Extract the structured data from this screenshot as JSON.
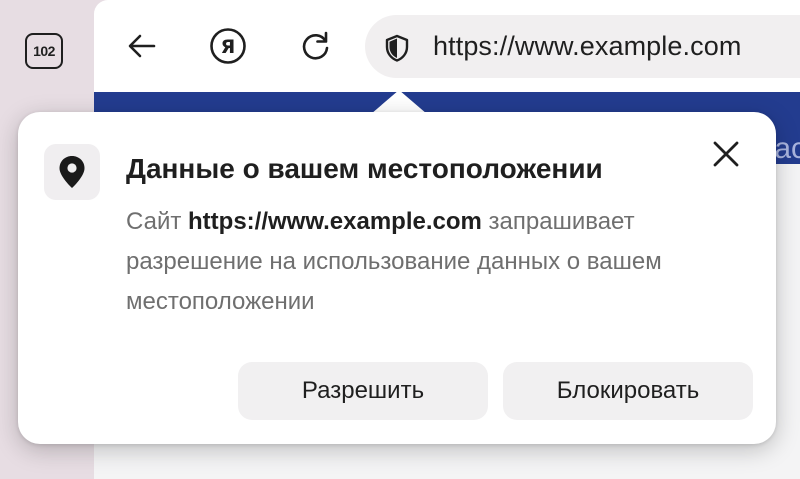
{
  "tabs": {
    "count_label": "102"
  },
  "toolbar": {
    "back_icon": "arrow-left-icon",
    "yandex_icon": "yandex-logo-icon",
    "reload_icon": "reload-icon",
    "address": "https://www.example.com",
    "security_icon": "shield-icon"
  },
  "page": {
    "banner_text": "ac"
  },
  "permission_popup": {
    "icon": "location-pin-icon",
    "title": "Данные о вашем местоположении",
    "description_prefix": "Сайт ",
    "site": "https://www.example.com",
    "description_suffix": " запрашивает разрешение на использование данных о вашем местоположении",
    "close_icon": "close-icon",
    "allow_label": "Разрешить",
    "block_label": "Блокировать"
  },
  "colors": {
    "window_frame": "#e7dde3",
    "banner": "#233c8f",
    "popup_bg": "#ffffff",
    "button_bg": "#f1f0f1"
  }
}
